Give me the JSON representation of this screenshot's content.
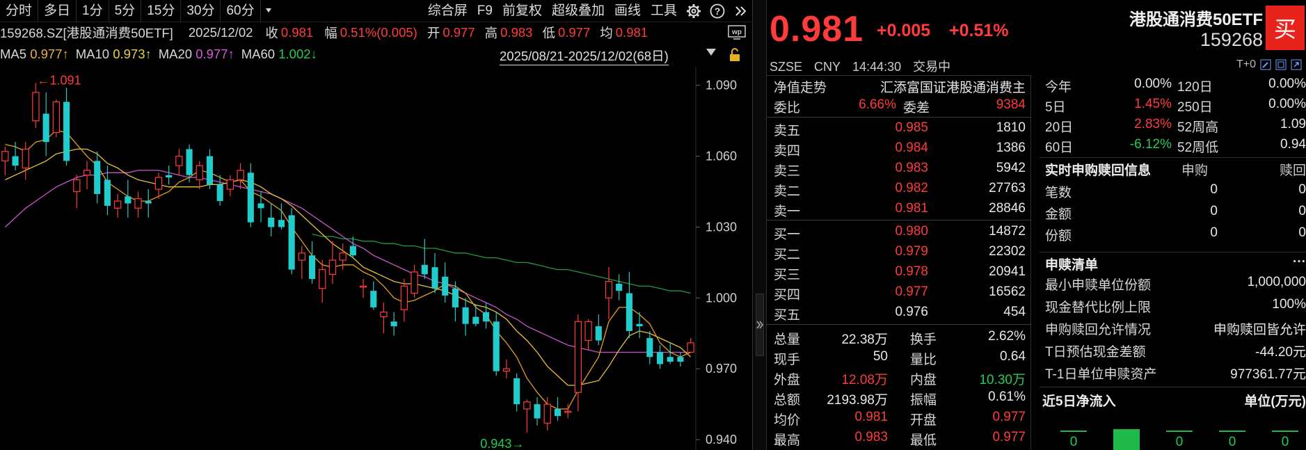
{
  "toolbar": {
    "periods": [
      "分时",
      "多日",
      "1分",
      "5分",
      "15分",
      "30分",
      "60分"
    ],
    "active_period": "",
    "tools": [
      "综合屏",
      "F9",
      "前复权",
      "超级叠加",
      "画线",
      "工具"
    ],
    "icons": [
      "gear-icon",
      "help-icon",
      "expand-icon"
    ]
  },
  "quote_line": {
    "code": "159268.SZ[港股通消费50ETF]",
    "date": "2025/12/02",
    "close_label": "收",
    "close": "0.981",
    "amp_label": "幅",
    "amp": "0.51%(0.005)",
    "open_label": "开",
    "open": "0.977",
    "high_label": "高",
    "high": "0.983",
    "low_label": "低",
    "low": "0.977",
    "avg_label": "均",
    "avg": "0.981"
  },
  "ma_line": {
    "ma5_label": "MA5",
    "ma5": "0.977↑",
    "ma10_label": "MA10",
    "ma10": "0.973↑",
    "ma20_label": "MA20",
    "ma20": "0.977↑",
    "ma60_label": "MA60",
    "ma60": "1.002↓",
    "range": "2025/08/21-2025/12/02(68日)"
  },
  "colors": {
    "up": "#ff3b3b",
    "down": "#22cccc",
    "ma5": "#e8e8e8",
    "ma10": "#e8c23a",
    "ma20": "#cc55cc",
    "ma60": "#1f9a46",
    "accent": "#e8231b"
  },
  "chart_data": {
    "type": "candlestick",
    "y_ticks": [
      "1.090",
      "1.060",
      "1.030",
      "1.000",
      "0.970",
      "0.940"
    ],
    "ylim": [
      0.9365,
      1.0955
    ],
    "high_annotation": "←1.091",
    "low_annotation": "0.943→",
    "candles": [
      {
        "o": 1.058,
        "h": 1.064,
        "l": 1.052,
        "c": 1.062
      },
      {
        "o": 1.06,
        "h": 1.066,
        "l": 1.054,
        "c": 1.056
      },
      {
        "o": 1.055,
        "h": 1.066,
        "l": 1.05,
        "c": 1.063
      },
      {
        "o": 1.075,
        "h": 1.091,
        "l": 1.072,
        "c": 1.087
      },
      {
        "o": 1.078,
        "h": 1.087,
        "l": 1.06,
        "c": 1.066
      },
      {
        "o": 1.07,
        "h": 1.084,
        "l": 1.068,
        "c": 1.083
      },
      {
        "o": 1.083,
        "h": 1.089,
        "l": 1.056,
        "c": 1.058
      },
      {
        "o": 1.045,
        "h": 1.052,
        "l": 1.038,
        "c": 1.05
      },
      {
        "o": 1.052,
        "h": 1.058,
        "l": 1.046,
        "c": 1.054
      },
      {
        "o": 1.058,
        "h": 1.062,
        "l": 1.04,
        "c": 1.044
      },
      {
        "o": 1.05,
        "h": 1.056,
        "l": 1.035,
        "c": 1.039
      },
      {
        "o": 1.038,
        "h": 1.044,
        "l": 1.034,
        "c": 1.041
      },
      {
        "o": 1.043,
        "h": 1.05,
        "l": 1.034,
        "c": 1.04
      },
      {
        "o": 1.038,
        "h": 1.045,
        "l": 1.034,
        "c": 1.042
      },
      {
        "o": 1.041,
        "h": 1.046,
        "l": 1.034,
        "c": 1.04
      },
      {
        "o": 1.046,
        "h": 1.053,
        "l": 1.042,
        "c": 1.051
      },
      {
        "o": 1.052,
        "h": 1.056,
        "l": 1.048,
        "c": 1.051
      },
      {
        "o": 1.056,
        "h": 1.063,
        "l": 1.052,
        "c": 1.06
      },
      {
        "o": 1.063,
        "h": 1.065,
        "l": 1.049,
        "c": 1.052
      },
      {
        "o": 1.05,
        "h": 1.058,
        "l": 1.046,
        "c": 1.056
      },
      {
        "o": 1.06,
        "h": 1.063,
        "l": 1.046,
        "c": 1.048
      },
      {
        "o": 1.048,
        "h": 1.052,
        "l": 1.039,
        "c": 1.041
      },
      {
        "o": 1.046,
        "h": 1.052,
        "l": 1.043,
        "c": 1.05
      },
      {
        "o": 1.05,
        "h": 1.057,
        "l": 1.046,
        "c": 1.054
      },
      {
        "o": 1.053,
        "h": 1.057,
        "l": 1.03,
        "c": 1.032
      },
      {
        "o": 1.04,
        "h": 1.045,
        "l": 1.032,
        "c": 1.038
      },
      {
        "o": 1.034,
        "h": 1.04,
        "l": 1.026,
        "c": 1.03
      },
      {
        "o": 1.033,
        "h": 1.04,
        "l": 1.029,
        "c": 1.03
      },
      {
        "o": 1.035,
        "h": 1.038,
        "l": 1.01,
        "c": 1.012
      },
      {
        "o": 1.016,
        "h": 1.022,
        "l": 1.008,
        "c": 1.019
      },
      {
        "o": 1.018,
        "h": 1.024,
        "l": 1.006,
        "c": 1.008
      },
      {
        "o": 1.004,
        "h": 1.016,
        "l": 0.998,
        "c": 1.012
      },
      {
        "o": 1.01,
        "h": 1.024,
        "l": 1.006,
        "c": 1.016
      },
      {
        "o": 1.016,
        "h": 1.023,
        "l": 1.012,
        "c": 1.019
      },
      {
        "o": 1.022,
        "h": 1.026,
        "l": 1.017,
        "c": 1.018
      },
      {
        "o": 1.005,
        "h": 1.008,
        "l": 1.0,
        "c": 1.005
      },
      {
        "o": 1.003,
        "h": 1.007,
        "l": 0.995,
        "c": 0.996
      },
      {
        "o": 0.992,
        "h": 0.998,
        "l": 0.985,
        "c": 0.994
      },
      {
        "o": 0.99,
        "h": 0.994,
        "l": 0.984,
        "c": 0.988
      },
      {
        "o": 0.995,
        "h": 1.008,
        "l": 0.99,
        "c": 1.005
      },
      {
        "o": 1.002,
        "h": 1.014,
        "l": 1.0,
        "c": 1.011
      },
      {
        "o": 1.014,
        "h": 1.025,
        "l": 1.008,
        "c": 1.01
      },
      {
        "o": 1.013,
        "h": 1.019,
        "l": 1.002,
        "c": 1.004
      },
      {
        "o": 1.009,
        "h": 1.015,
        "l": 0.998,
        "c": 1.001
      },
      {
        "o": 1.004,
        "h": 1.007,
        "l": 0.99,
        "c": 0.996
      },
      {
        "o": 0.996,
        "h": 1.0,
        "l": 0.984,
        "c": 0.989
      },
      {
        "o": 0.992,
        "h": 0.997,
        "l": 0.988,
        "c": 0.989
      },
      {
        "o": 0.994,
        "h": 0.998,
        "l": 0.987,
        "c": 0.99
      },
      {
        "o": 0.99,
        "h": 0.994,
        "l": 0.967,
        "c": 0.969
      },
      {
        "o": 0.969,
        "h": 0.974,
        "l": 0.966,
        "c": 0.97
      },
      {
        "o": 0.966,
        "h": 0.968,
        "l": 0.952,
        "c": 0.955
      },
      {
        "o": 0.953,
        "h": 0.957,
        "l": 0.943,
        "c": 0.956
      },
      {
        "o": 0.955,
        "h": 0.958,
        "l": 0.946,
        "c": 0.949
      },
      {
        "o": 0.947,
        "h": 0.958,
        "l": 0.944,
        "c": 0.955
      },
      {
        "o": 0.953,
        "h": 0.958,
        "l": 0.948,
        "c": 0.95
      },
      {
        "o": 0.952,
        "h": 0.955,
        "l": 0.949,
        "c": 0.952
      },
      {
        "o": 0.96,
        "h": 0.993,
        "l": 0.952,
        "c": 0.99
      },
      {
        "o": 0.982,
        "h": 0.991,
        "l": 0.978,
        "c": 0.99
      },
      {
        "o": 0.988,
        "h": 0.993,
        "l": 0.98,
        "c": 0.982
      },
      {
        "o": 1.0,
        "h": 1.013,
        "l": 0.991,
        "c": 1.007
      },
      {
        "o": 1.006,
        "h": 1.01,
        "l": 0.999,
        "c": 1.003
      },
      {
        "o": 1.002,
        "h": 1.011,
        "l": 0.983,
        "c": 0.986
      },
      {
        "o": 0.989,
        "h": 0.994,
        "l": 0.983,
        "c": 0.988
      },
      {
        "o": 0.983,
        "h": 0.986,
        "l": 0.972,
        "c": 0.975
      },
      {
        "o": 0.977,
        "h": 0.98,
        "l": 0.97,
        "c": 0.972
      },
      {
        "o": 0.975,
        "h": 0.981,
        "l": 0.972,
        "c": 0.973
      },
      {
        "o": 0.975,
        "h": 0.977,
        "l": 0.971,
        "c": 0.973
      },
      {
        "o": 0.977,
        "h": 0.983,
        "l": 0.977,
        "c": 0.981
      }
    ],
    "ma5": [
      1.065,
      1.064,
      1.062,
      1.066,
      1.067,
      1.071,
      1.07,
      1.065,
      1.06,
      1.056,
      1.049,
      1.046,
      1.043,
      1.041,
      1.041,
      1.043,
      1.045,
      1.049,
      1.051,
      1.054,
      1.053,
      1.051,
      1.049,
      1.05,
      1.045,
      1.043,
      1.04,
      1.037,
      1.03,
      1.024,
      1.018,
      1.014,
      1.013,
      1.014,
      1.014,
      1.011,
      1.009,
      1.005,
      1.0,
      0.998,
      0.999,
      1.001,
      1.003,
      1.006,
      1.005,
      1.002,
      0.996,
      0.993,
      0.986,
      0.981,
      0.975,
      0.966,
      0.96,
      0.955,
      0.953,
      0.953,
      0.961,
      0.968,
      0.975,
      0.99,
      0.996,
      0.996,
      0.993,
      0.989,
      0.981,
      0.977,
      0.975,
      0.977
    ],
    "ma10": [
      1.05,
      1.052,
      1.054,
      1.056,
      1.058,
      1.061,
      1.062,
      1.063,
      1.063,
      1.061,
      1.057,
      1.055,
      1.052,
      1.05,
      1.049,
      1.048,
      1.047,
      1.047,
      1.047,
      1.047,
      1.048,
      1.048,
      1.049,
      1.05,
      1.049,
      1.047,
      1.044,
      1.042,
      1.039,
      1.035,
      1.031,
      1.027,
      1.023,
      1.02,
      1.017,
      1.013,
      1.011,
      1.009,
      1.007,
      1.006,
      1.006,
      1.005,
      1.004,
      1.003,
      1.001,
      0.999,
      0.997,
      0.996,
      0.994,
      0.991,
      0.986,
      0.982,
      0.977,
      0.971,
      0.967,
      0.963,
      0.963,
      0.964,
      0.965,
      0.971,
      0.978,
      0.984,
      0.986,
      0.985,
      0.983,
      0.981,
      0.979,
      0.975
    ],
    "ma20": [
      1.03,
      1.034,
      1.038,
      1.041,
      1.044,
      1.047,
      1.049,
      1.051,
      1.052,
      1.052,
      1.053,
      1.053,
      1.053,
      1.054,
      1.054,
      1.054,
      1.053,
      1.052,
      1.051,
      1.051,
      1.05,
      1.049,
      1.048,
      1.047,
      1.046,
      1.045,
      1.044,
      1.042,
      1.04,
      1.038,
      1.035,
      1.032,
      1.029,
      1.026,
      1.023,
      1.021,
      1.018,
      1.016,
      1.014,
      1.012,
      1.01,
      1.009,
      1.007,
      1.006,
      1.004,
      1.002,
      1.0,
      0.998,
      0.996,
      0.993,
      0.991,
      0.988,
      0.986,
      0.984,
      0.982,
      0.98,
      0.979,
      0.978,
      0.977,
      0.977,
      0.977,
      0.977,
      0.977,
      0.977,
      0.977,
      0.977,
      0.977,
      0.977
    ],
    "ma60_start_index": 30,
    "ma60": [
      1.027,
      1.026,
      1.026,
      1.025,
      1.025,
      1.024,
      1.024,
      1.023,
      1.023,
      1.022,
      1.022,
      1.021,
      1.021,
      1.02,
      1.019,
      1.019,
      1.018,
      1.017,
      1.017,
      1.016,
      1.015,
      1.015,
      1.014,
      1.013,
      1.012,
      1.012,
      1.011,
      1.01,
      1.009,
      1.008,
      1.007,
      1.006,
      1.005,
      1.005,
      1.004,
      1.003,
      1.003,
      1.002
    ]
  },
  "panel": {
    "price": "0.981",
    "change": "+0.005",
    "pct": "+0.51%",
    "name": "港股通消费50ETF",
    "code": "159268",
    "buy": "买",
    "exchange": "SZSE",
    "currency": "CNY",
    "time": "14:44:30",
    "status": "交易中",
    "t0": "T+0",
    "nav_label": "净值走势",
    "fund_full": "汇添富国证港股通消费主",
    "weibi_label": "委比",
    "weibi": "6.66%",
    "weicha_label": "委差",
    "weicha": "9384",
    "asks": [
      {
        "label": "卖五",
        "price": "0.985",
        "vol": "1810"
      },
      {
        "label": "卖四",
        "price": "0.984",
        "vol": "1386"
      },
      {
        "label": "卖三",
        "price": "0.983",
        "vol": "5942"
      },
      {
        "label": "卖二",
        "price": "0.982",
        "vol": "27763"
      },
      {
        "label": "卖一",
        "price": "0.981",
        "vol": "28846"
      }
    ],
    "bids": [
      {
        "label": "买一",
        "price": "0.980",
        "vol": "14872"
      },
      {
        "label": "买二",
        "price": "0.979",
        "vol": "22302"
      },
      {
        "label": "买三",
        "price": "0.978",
        "vol": "20941"
      },
      {
        "label": "买四",
        "price": "0.977",
        "vol": "16562"
      },
      {
        "label": "买五",
        "price": "0.976",
        "vol": "454"
      }
    ],
    "stats": [
      {
        "a": "总量",
        "b": "22.38万",
        "c": "换手",
        "d": "2.62%"
      },
      {
        "a": "现手",
        "b": "50",
        "c": "量比",
        "d": "0.64"
      },
      {
        "a": "外盘",
        "b": "12.08万",
        "c": "内盘",
        "d": "10.30万"
      },
      {
        "a": "总额",
        "b": "2193.98万",
        "c": "振幅",
        "d": "0.61%"
      },
      {
        "a": "均价",
        "b": "0.981",
        "c": "开盘",
        "d": "0.977"
      },
      {
        "a": "最高",
        "b": "0.983",
        "c": "最低",
        "d": "0.977"
      }
    ],
    "perf": [
      {
        "a": "今年",
        "b": "0.00%",
        "c": "120日",
        "d": "0.00%"
      },
      {
        "a": "5日",
        "b": "1.45%",
        "c": "250日",
        "d": "0.00%"
      },
      {
        "a": "20日",
        "b": "2.83%",
        "c": "52周高",
        "d": "1.09"
      },
      {
        "a": "60日",
        "b": "-6.12%",
        "c": "52周低",
        "d": "0.94"
      }
    ],
    "redeem": {
      "title": "实时申购赎回信息",
      "col1": "申购",
      "col2": "赎回",
      "rows": [
        {
          "a": "笔数",
          "b": "0",
          "c": "0"
        },
        {
          "a": "金额",
          "b": "0",
          "c": "0"
        },
        {
          "a": "份额",
          "b": "0",
          "c": "0"
        }
      ]
    },
    "list": {
      "title": "申赎清单",
      "more": "···",
      "rows": [
        {
          "a": "最小申赎单位份额",
          "b": "1,000,000"
        },
        {
          "a": "现金替代比例上限",
          "b": "100%"
        },
        {
          "a": "申购赎回允许情况",
          "b": "申购赎回皆允许"
        },
        {
          "a": "T日预估现金差额",
          "b": "-44.20元"
        },
        {
          "a": "T-1日单位申赎资产",
          "b": "977361.77元"
        }
      ]
    },
    "flow": {
      "title": "近5日净流入",
      "unit": "单位(万元)",
      "values": [
        "0",
        "",
        "0",
        "0",
        "0"
      ]
    }
  }
}
